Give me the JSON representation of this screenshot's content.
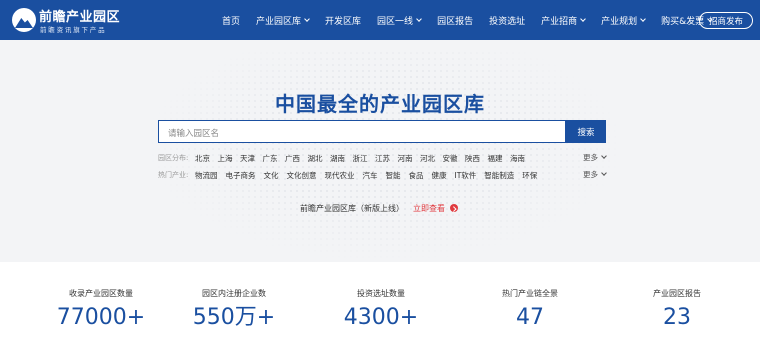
{
  "brand": {
    "name": "前瞻产业园区",
    "tagline": "前瞻资讯旗下产品"
  },
  "nav": {
    "items": [
      {
        "label": "首页"
      },
      {
        "label": "产业园区库"
      },
      {
        "label": "开发区库"
      },
      {
        "label": "园区一线"
      },
      {
        "label": "园区报告"
      },
      {
        "label": "投资选址"
      },
      {
        "label": "产业招商"
      },
      {
        "label": "产业规划"
      },
      {
        "label": "购买&发票"
      }
    ],
    "post_button": "招商发布"
  },
  "hero": {
    "title": "中国最全的产业园区库",
    "search_placeholder": "请输入园区名",
    "search_button": "搜索",
    "filters": {
      "region_label": "园区分布:",
      "regions": [
        "北京",
        "上海",
        "天津",
        "广东",
        "广西",
        "湖北",
        "湖南",
        "浙江",
        "江苏",
        "河南",
        "河北",
        "安徽",
        "陕西",
        "福建",
        "海南"
      ],
      "industry_label": "热门产业:",
      "industries": [
        "物流园",
        "电子商务",
        "文化",
        "文化创意",
        "现代农业",
        "汽车",
        "智能",
        "食品",
        "健康",
        "IT软件",
        "智能制造",
        "环保"
      ],
      "more_label": "更多"
    },
    "promo": {
      "text": "前瞻产业园区库（新版上线）",
      "link": "立即查看"
    }
  },
  "stats": [
    {
      "label": "收录产业园区数量",
      "value": "77000+"
    },
    {
      "label": "园区内注册企业数",
      "value": "550万+"
    },
    {
      "label": "投资选址数量",
      "value": "4300+"
    },
    {
      "label": "热门产业链全景",
      "value": "47"
    },
    {
      "label": "产业园区报告",
      "value": "23"
    }
  ],
  "colors": {
    "primary": "#1a4fa0",
    "accent_red": "#e0393e",
    "background": "#f3f4f6"
  }
}
